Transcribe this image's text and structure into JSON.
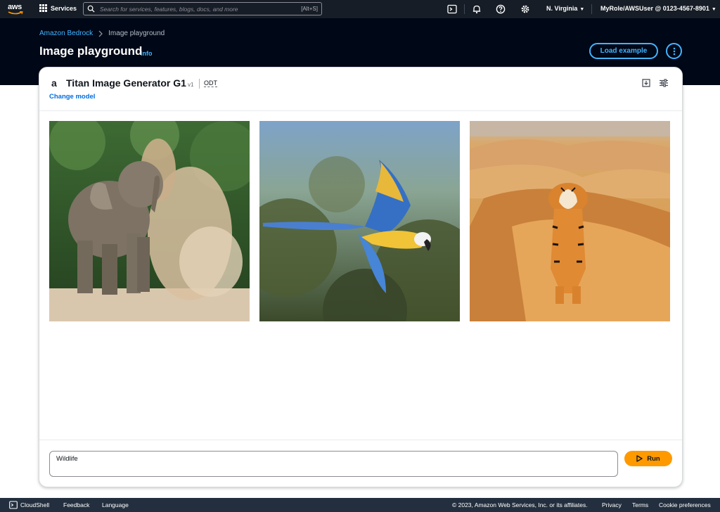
{
  "topnav": {
    "logo_text": "aws",
    "services_label": "Services",
    "search_placeholder": "Search for services, features, blogs, docs, and more",
    "search_shortcut": "[Alt+S]",
    "region": "N. Virginia",
    "account": "MyRole/AWSUser @ 0123-4567-8901",
    "icons": [
      "cloudshell-icon",
      "bell-icon",
      "help-icon",
      "gear-icon"
    ]
  },
  "breadcrumb": {
    "items": [
      {
        "label": "Amazon Bedrock"
      },
      {
        "label": "Image playground"
      }
    ]
  },
  "header": {
    "title": "Image playground",
    "info_label": "Info",
    "load_example_label": "Load example"
  },
  "model": {
    "name": "Titan Image Generator G1",
    "version": "v1",
    "throughput": "ODT",
    "change_label": "Change model"
  },
  "images": [
    {
      "subject": "elephant"
    },
    {
      "subject": "macaw"
    },
    {
      "subject": "tiger"
    }
  ],
  "prompt": {
    "value": "Wildlife"
  },
  "run_label": "Run",
  "footer": {
    "cloudshell": "CloudShell",
    "feedback": "Feedback",
    "language": "Language",
    "copyright": "© 2023, Amazon Web Services, Inc. or its affiliates.",
    "privacy": "Privacy",
    "terms": "Terms",
    "cookies": "Cookie preferences"
  },
  "colors": {
    "nav_bg": "#161d26",
    "header_bg": "#000716",
    "link": "#42b4ff",
    "accent": "#ff9900",
    "footer_bg": "#232f3e"
  }
}
